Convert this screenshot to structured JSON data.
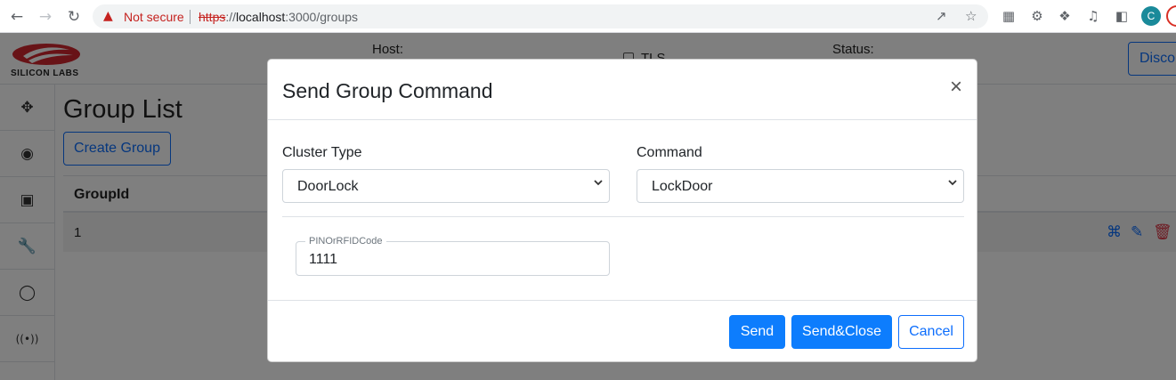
{
  "browser": {
    "security_label": "Not secure",
    "url_protocol": "https",
    "url_separator": "://",
    "url_host": "localhost",
    "url_path": ":3000/groups",
    "profile_initial": "C",
    "icons": [
      "back-icon",
      "forward-icon",
      "reload-icon",
      "warning-icon",
      "share-icon",
      "bookmark-star-icon",
      "qr-code-icon",
      "extension-gear-icon",
      "puzzle-extensions-icon",
      "media-queue-icon",
      "side-panel-icon"
    ]
  },
  "header": {
    "logo_text": "SILICON LABS",
    "host_label": "Host:",
    "tls_label": "TLS",
    "status_label": "Status:",
    "disconnect_label": "Disco"
  },
  "sidebar": {
    "items": [
      {
        "icon": "network-nodes-icon"
      },
      {
        "icon": "bug-icon"
      },
      {
        "icon": "chip-icon"
      },
      {
        "icon": "wrench-icon"
      },
      {
        "icon": "toggles-icon"
      },
      {
        "icon": "broadcast-icon"
      }
    ]
  },
  "main": {
    "title": "Group List",
    "create_label": "Create Group",
    "table": {
      "columns": [
        "GroupId"
      ],
      "rows": [
        [
          "1"
        ]
      ]
    }
  },
  "modal": {
    "title": "Send Group Command",
    "close_symbol": "×",
    "cluster_label": "Cluster Type",
    "cluster_value": "DoorLock",
    "command_label": "Command",
    "command_value": "LockDoor",
    "param_label": "PINOrRFIDCode",
    "param_value": "1111",
    "send_label": "Send",
    "send_close_label": "Send&Close",
    "cancel_label": "Cancel"
  },
  "colors": {
    "primary": "#0d7dfd",
    "warning": "#c5221f",
    "backdrop": "rgba(0,0,0,0.5)"
  }
}
